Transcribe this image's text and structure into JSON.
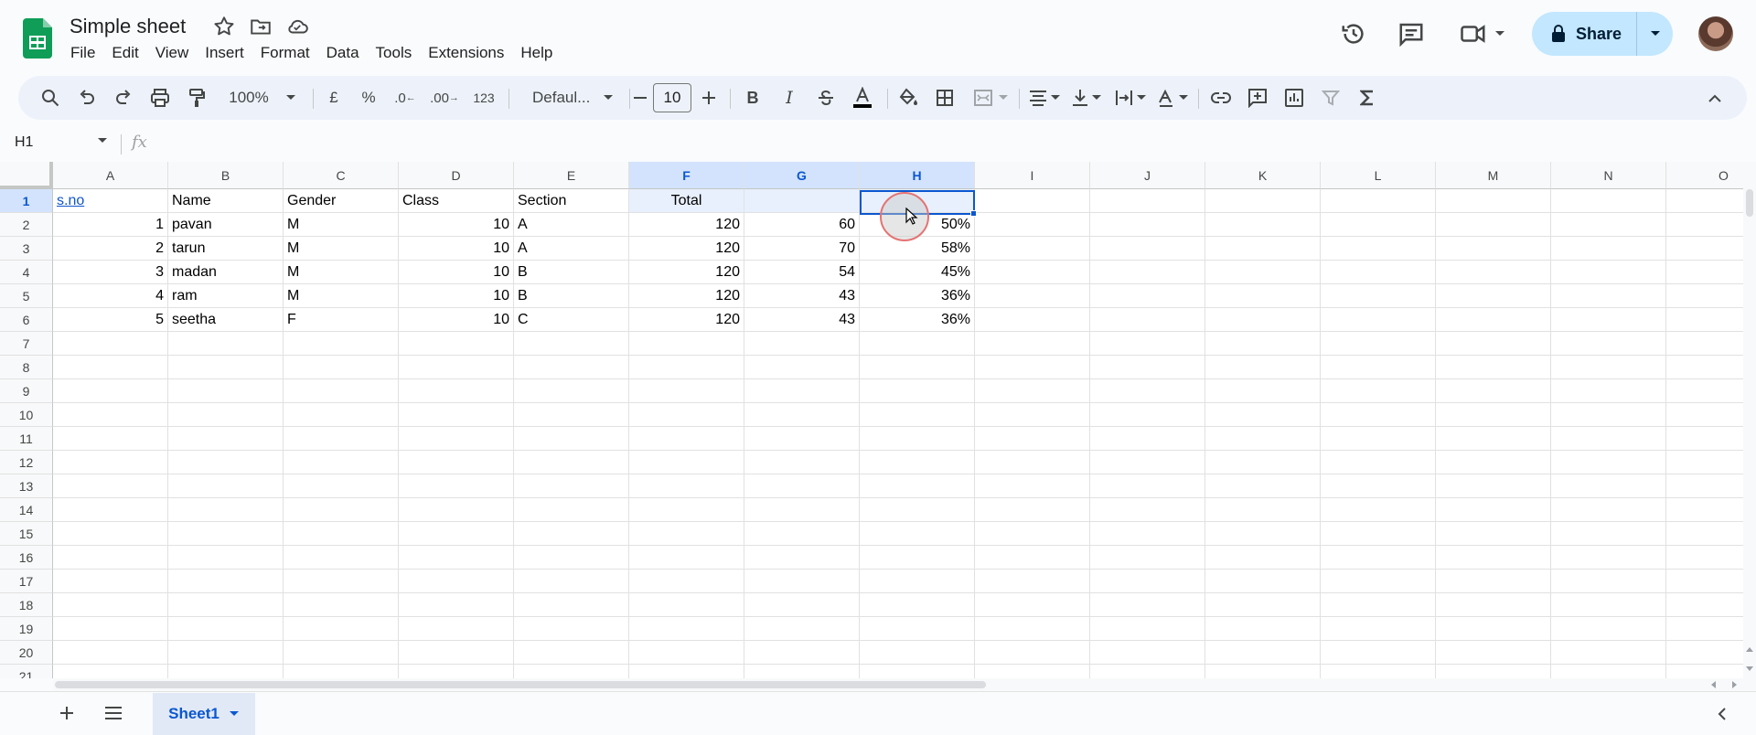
{
  "app": {
    "title": "Simple sheet",
    "menu": [
      "File",
      "Edit",
      "View",
      "Insert",
      "Format",
      "Data",
      "Tools",
      "Extensions",
      "Help"
    ],
    "share_label": "Share",
    "accent": "#0b57d0",
    "brand_green": "#0f9d58"
  },
  "toolbar": {
    "zoom": "100%",
    "currency": "£",
    "percent": "%",
    "decimal_decrease": ".0",
    "decimal_increase": ".00",
    "number_format": "123",
    "font_name": "Defaul...",
    "font_size": "10",
    "bold": "B",
    "italic": "I"
  },
  "formula_bar": {
    "name_box": "H1",
    "fx": "fx",
    "value": ""
  },
  "columns": [
    "A",
    "B",
    "C",
    "D",
    "E",
    "F",
    "G",
    "H",
    "I",
    "J",
    "K",
    "L",
    "M",
    "N",
    "O"
  ],
  "selected_columns": [
    "F",
    "G",
    "H"
  ],
  "rows": [
    "1",
    "2",
    "3",
    "4",
    "5",
    "6",
    "7",
    "8",
    "9",
    "10",
    "11",
    "12",
    "13",
    "14",
    "15",
    "16",
    "17",
    "18",
    "19",
    "20",
    "21"
  ],
  "cells": {
    "header": [
      "s.no",
      "Name",
      "Gender",
      "Class",
      "Section",
      "Total",
      "",
      ""
    ],
    "data": [
      [
        "1",
        "pavan",
        "M",
        "10",
        "A",
        "120",
        "60",
        "50%"
      ],
      [
        "2",
        "tarun",
        "M",
        "10",
        "A",
        "120",
        "70",
        "58%"
      ],
      [
        "3",
        "madan",
        "M",
        "10",
        "B",
        "120",
        "54",
        "45%"
      ],
      [
        "4",
        "ram",
        "M",
        "10",
        "B",
        "120",
        "43",
        "36%"
      ],
      [
        "5",
        "seetha",
        "F",
        "10",
        "C",
        "120",
        "43",
        "36%"
      ]
    ]
  },
  "sheets": [
    {
      "name": "Sheet1",
      "active": true
    }
  ]
}
